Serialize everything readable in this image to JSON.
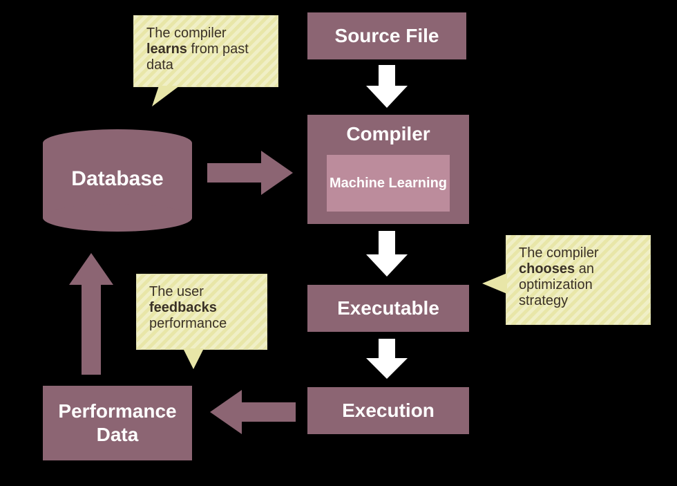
{
  "nodes": {
    "source_file": "Source File",
    "compiler": "Compiler",
    "machine_learning": "Machine Learning",
    "executable": "Executable",
    "execution": "Execution",
    "performance_data": "Performance Data",
    "database": "Database"
  },
  "callouts": {
    "learns_pre": "The compiler ",
    "learns_bold": "learns",
    "learns_post": " from past data",
    "chooses_pre": "The compiler ",
    "chooses_bold": "chooses",
    "chooses_post": " an optimization strategy",
    "feedback_pre": "The user ",
    "feedback_bold": "feedbacks",
    "feedback_post": " performance"
  },
  "colors": {
    "box": "#8c6573",
    "inner": "#bc8c9c",
    "callout": "#e8e6a8",
    "arrow_white": "#ffffff",
    "arrow_color": "#8c6573"
  }
}
